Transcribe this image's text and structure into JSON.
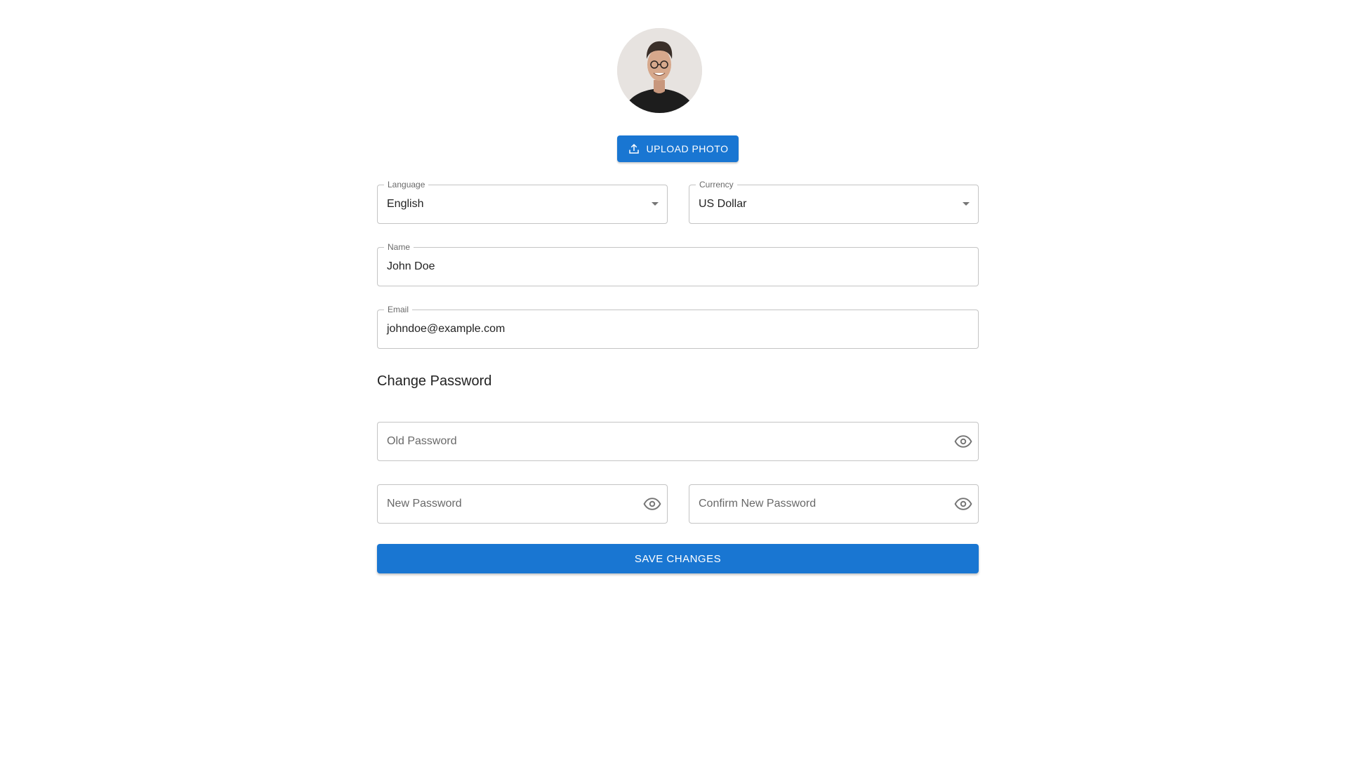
{
  "profile": {
    "avatar_alt": "Profile photo",
    "upload_label": "UPLOAD PHOTO"
  },
  "language": {
    "label": "Language",
    "value": "English"
  },
  "currency": {
    "label": "Currency",
    "value": "US Dollar"
  },
  "name": {
    "label": "Name",
    "value": "John Doe"
  },
  "email": {
    "label": "Email",
    "value": "johndoe@example.com"
  },
  "change_password": {
    "title": "Change Password",
    "old_placeholder": "Old Password",
    "new_placeholder": "New Password",
    "confirm_placeholder": "Confirm New Password"
  },
  "save_label": "SAVE CHANGES",
  "colors": {
    "primary": "#1976d2",
    "border": "#c4c4c4",
    "text": "#222222"
  },
  "icons": {
    "upload": "upload-icon",
    "visibility": "eye-icon",
    "dropdown": "caret-down-icon"
  }
}
